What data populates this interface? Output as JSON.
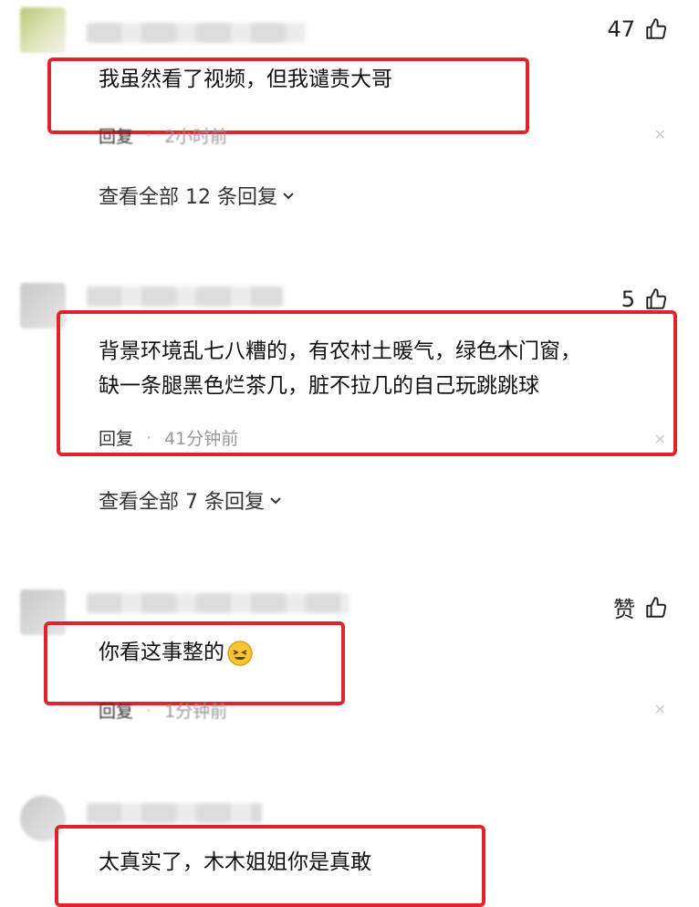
{
  "comments": [
    {
      "likes": "47",
      "text": "我虽然看了视频，但我谴责大哥",
      "reply_label": "回复",
      "time": "2小时前",
      "view_all": "查看全部 12 条回复"
    },
    {
      "likes": "5",
      "text_line1": "背景环境乱七八糟的，有农村土暖气，绿色木门窗，",
      "text_line2": "缺一条腿黑色烂茶几，脏不拉几的自己玩跳跳球",
      "reply_label": "回复",
      "time": "41分钟前",
      "view_all": "查看全部 7 条回复"
    },
    {
      "likes": "赞",
      "text": "你看这事整的",
      "reply_label": "回复",
      "time": "1分钟前"
    },
    {
      "text": "太真实了，木木姐姐你是真敢"
    }
  ],
  "colors": {
    "highlight": "#e0242b"
  },
  "icons": {
    "like": "thumbs-up-icon",
    "expand": "chevron-down-icon",
    "close": "close-icon",
    "emoji": "laughing-emoji-icon"
  }
}
